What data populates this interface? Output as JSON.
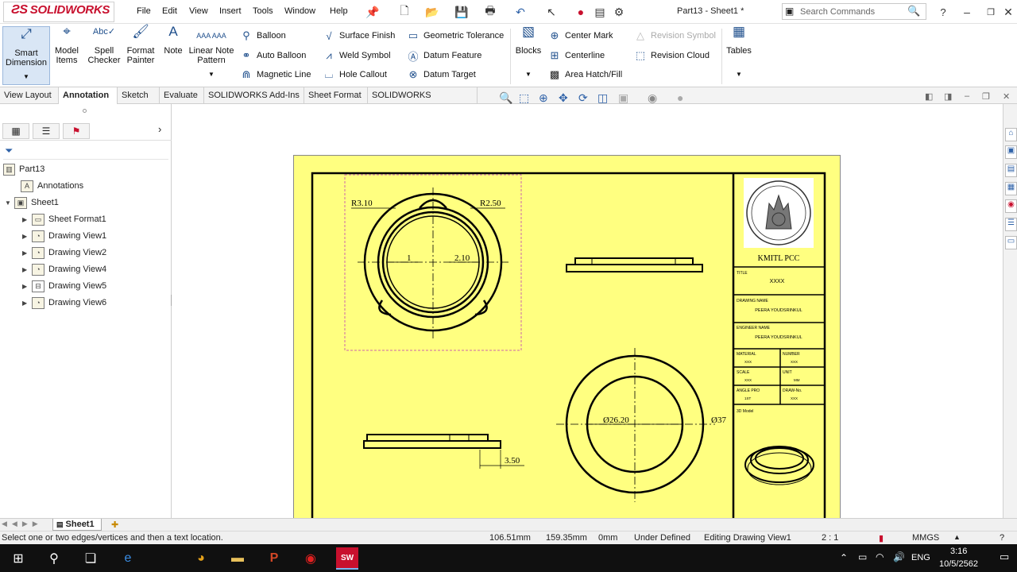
{
  "app": {
    "name": "SOLIDWORKS",
    "doc_title": "Part13 - Sheet1 *"
  },
  "menu": [
    "File",
    "Edit",
    "View",
    "Insert",
    "Tools",
    "Window",
    "Help"
  ],
  "search": {
    "placeholder": "Search Commands"
  },
  "ribbon": {
    "smart_dimension": "Smart Dimension",
    "model_items": "Model Items",
    "spell_checker": "Spell Checker",
    "format_painter": "Format Painter",
    "note": "Note",
    "linear_note_pattern": "Linear Note Pattern",
    "balloon": "Balloon",
    "auto_balloon": "Auto Balloon",
    "magnetic_line": "Magnetic Line",
    "surface_finish": "Surface Finish",
    "weld_symbol": "Weld Symbol",
    "hole_callout": "Hole Callout",
    "geometric_tolerance": "Geometric Tolerance",
    "datum_feature": "Datum Feature",
    "datum_target": "Datum Target",
    "blocks": "Blocks",
    "center_mark": "Center Mark",
    "centerline": "Centerline",
    "area_hatch": "Area Hatch/Fill",
    "revision_symbol": "Revision Symbol",
    "revision_cloud": "Revision Cloud",
    "tables": "Tables"
  },
  "tabs": [
    "View Layout",
    "Annotation",
    "Sketch",
    "Evaluate",
    "SOLIDWORKS Add-Ins",
    "Sheet Format",
    "SOLIDWORKS Inspection"
  ],
  "active_tab": "Annotation",
  "tree": {
    "root": "Part13",
    "annotations": "Annotations",
    "sheet": "Sheet1",
    "children": [
      "Sheet Format1",
      "Drawing View1",
      "Drawing View2",
      "Drawing View4",
      "Drawing View5",
      "Drawing View6"
    ]
  },
  "drawing": {
    "dim_r1": "R3.10",
    "dim_r2": "R2.50",
    "dim_1": "1",
    "dim_210": "2.10",
    "dim_350": "3.50",
    "dim_d1": "Ø26.20",
    "dim_d2": "Ø37",
    "title_block": {
      "org": "KMITL PCC",
      "title_label": "TITLE",
      "title_value": "XXXX",
      "drawing_name_label": "DRAWING NAME",
      "drawing_name_value": "PEERA YOUDSRINKUL",
      "engineer_label": "ENGINEER NAME",
      "engineer_value": "PEERA YOUDSRINKUL",
      "material_label": "MATERIAL",
      "material_value": "XXX",
      "number_label": "NUMBER",
      "number_value": "XXX",
      "scale_label": "SCALE",
      "scale_value": "XXX",
      "unit_label": "UNIT",
      "unit_value": "MM",
      "angle_label": "ANGLE PRO",
      "angle_value": "1ST",
      "draw_no_label": "DRAW-No.",
      "draw_no_value": "XXX",
      "model_label": "3D Model"
    }
  },
  "sheet_tab": "Sheet1",
  "status": {
    "message": "Select one or two edges/vertices and then a text location.",
    "x": "106.51mm",
    "y": "159.35mm",
    "z": "0mm",
    "state": "Under Defined",
    "editing": "Editing Drawing View1",
    "scale": "2 : 1",
    "units": "MMGS"
  },
  "taskbar": {
    "lang": "ENG",
    "time": "3:16",
    "date": "10/5/2562"
  },
  "colors": {
    "sheet": "#ffff80",
    "accent": "#c8102e",
    "selection": "#cc66aa"
  }
}
